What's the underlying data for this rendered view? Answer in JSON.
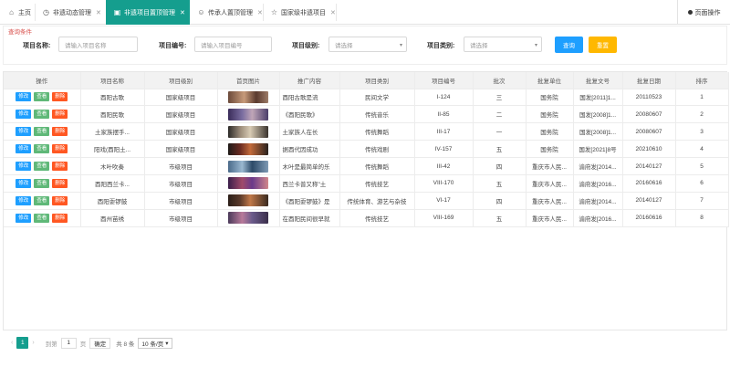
{
  "tabs": [
    {
      "label": "主页",
      "icon": "home-icon",
      "glyph": "⌂",
      "closable": false,
      "active": false
    },
    {
      "label": "非遗动态管理",
      "icon": "clock-icon",
      "glyph": "◷",
      "closable": true,
      "active": false
    },
    {
      "label": "非遗项目置顶管理",
      "icon": "bookmark-icon",
      "glyph": "▣",
      "closable": true,
      "active": true
    },
    {
      "label": "传承人置顶管理",
      "icon": "smile-icon",
      "glyph": "☺",
      "closable": true,
      "active": false
    },
    {
      "label": "国家级非遗项目",
      "icon": "star-icon",
      "glyph": "☆",
      "closable": true,
      "active": false
    }
  ],
  "page_ops": "页面操作",
  "query": {
    "title": "查询条件",
    "name_label": "项目名称:",
    "name_placeholder": "请输入项目名称",
    "code_label": "项目编号:",
    "code_placeholder": "请输入项目编号",
    "level_label": "项目级别:",
    "level_value": "请选择",
    "category_label": "项目类别:",
    "category_value": "请选择",
    "query_button": "查询",
    "reset_button": "重置"
  },
  "table": {
    "headers": [
      "操作",
      "项目名称",
      "项目级别",
      "首页图片",
      "推广内容",
      "项目类别",
      "项目编号",
      "批次",
      "批复单位",
      "批复文号",
      "批复日期",
      "排序"
    ],
    "op_labels": {
      "edit": "修改",
      "view": "查看",
      "delete": "删除"
    },
    "rows": [
      {
        "name": "酉阳古歌",
        "level": "国家级项目",
        "content": "酉阳古歌是流",
        "category": "民间文学",
        "code": "I-124",
        "batch": "三",
        "unit": "国务院",
        "doc": "国发[2011]1...",
        "date": "20110523",
        "order": "1"
      },
      {
        "name": "酉阳民歌",
        "level": "国家级项目",
        "content": "《酉阳民歌》",
        "category": "传统音乐",
        "code": "II-85",
        "batch": "二",
        "unit": "国务院",
        "doc": "国发[2008]1...",
        "date": "20080607",
        "order": "2"
      },
      {
        "name": "土家族摆手...",
        "level": "国家级项目",
        "content": "土家族人在长",
        "category": "传统舞蹈",
        "code": "III-17",
        "batch": "一",
        "unit": "国务院",
        "doc": "国发[2008]1...",
        "date": "20080607",
        "order": "3"
      },
      {
        "name": "阳戏(酉阳土...",
        "level": "国家级项目",
        "content": "据酉代因成功",
        "category": "传统戏剧",
        "code": "IV-157",
        "batch": "五",
        "unit": "国务院",
        "doc": "国发[2021]8号",
        "date": "20210610",
        "order": "4"
      },
      {
        "name": "木叶吹奏",
        "level": "市级项目",
        "content": "木叶是最简单的乐",
        "category": "传统舞蹈",
        "code": "III-42",
        "batch": "四",
        "unit": "重庆市人民...",
        "doc": "渝府发[2014...",
        "date": "20140127",
        "order": "5"
      },
      {
        "name": "酉阳西兰卡...",
        "level": "市级项目",
        "content": "西兰卡普又称\"土",
        "category": "传统技艺",
        "code": "VIII-170",
        "batch": "五",
        "unit": "重庆市人民...",
        "doc": "渝府发[2016...",
        "date": "20160616",
        "order": "6"
      },
      {
        "name": "酉阳耍锣鼓",
        "level": "市级项目",
        "content": "《酉阳耍锣鼓》是",
        "category": "传统体育、游艺与杂技",
        "code": "VI-17",
        "batch": "四",
        "unit": "重庆市人民...",
        "doc": "渝府发[2014...",
        "date": "20140127",
        "order": "7"
      },
      {
        "name": "酉州苗绣",
        "level": "市级项目",
        "content": "在酉阳民间很早就",
        "category": "传统技艺",
        "code": "VIII-169",
        "batch": "五",
        "unit": "重庆市人民...",
        "doc": "渝府发[2016...",
        "date": "20160616",
        "order": "8"
      }
    ]
  },
  "pagination": {
    "prev": "‹",
    "current": "1",
    "next": "›",
    "goto_label": "到第",
    "goto_value": "1",
    "page_unit": "页",
    "confirm": "确定",
    "total": "共 8 条",
    "page_size": "10 条/页"
  },
  "colors": {
    "accent": "#159e8e",
    "edit": "#1e9fff",
    "view": "#5fb878",
    "delete": "#ff5722",
    "reset": "#ffb800"
  }
}
